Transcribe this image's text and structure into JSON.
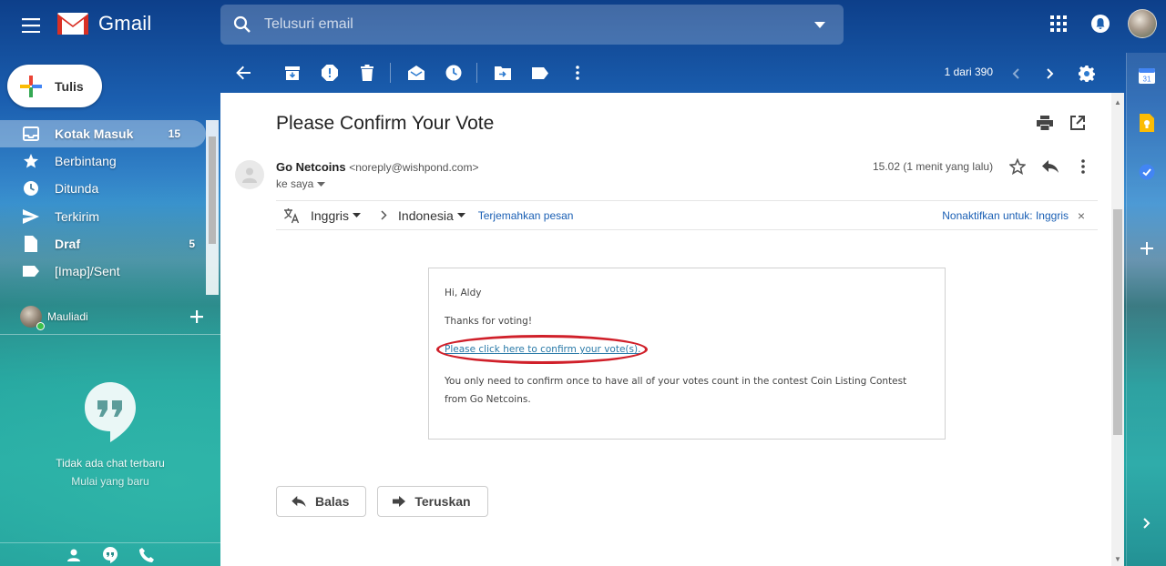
{
  "app": {
    "name": "Gmail"
  },
  "search": {
    "placeholder": "Telusuri email"
  },
  "compose": {
    "label": "Tulis"
  },
  "sidebar": {
    "items": [
      {
        "label": "Kotak Masuk",
        "count": "15",
        "icon": "inbox-icon"
      },
      {
        "label": "Berbintang",
        "count": "",
        "icon": "star-icon"
      },
      {
        "label": "Ditunda",
        "count": "",
        "icon": "clock-icon"
      },
      {
        "label": "Terkirim",
        "count": "",
        "icon": "send-icon"
      },
      {
        "label": "Draf",
        "count": "5",
        "icon": "draft-icon"
      },
      {
        "label": "[Imap]/Sent",
        "count": "",
        "icon": "label-icon"
      }
    ]
  },
  "hangouts": {
    "user_name": "Mauliadi",
    "empty_line1": "Tidak ada chat terbaru",
    "empty_line2": "Mulai yang baru"
  },
  "toolbar": {
    "pager": "1 dari 390"
  },
  "email": {
    "subject": "Please Confirm Your Vote",
    "sender_name": "Go Netcoins",
    "sender_email": "<noreply@wishpond.com>",
    "to": "ke saya",
    "date": "15.02 (1 menit yang lalu)",
    "translate": {
      "from_lang": "Inggris",
      "to_lang": "Indonesia",
      "translate_link": "Terjemahkan pesan",
      "disable_link": "Nonaktifkan untuk: Inggris"
    },
    "body": {
      "greeting": "Hi, Aldy",
      "thanks": "Thanks for voting!",
      "confirm_link": "Please click here to confirm your vote(s).",
      "note": "You only need to confirm once to have all of your votes count in the contest Coin Listing Contest from Go Netcoins."
    },
    "reply_label": "Balas",
    "forward_label": "Teruskan"
  },
  "colors": {
    "accent_link": "#1a5fb4",
    "highlight_oval": "#d0202a"
  }
}
